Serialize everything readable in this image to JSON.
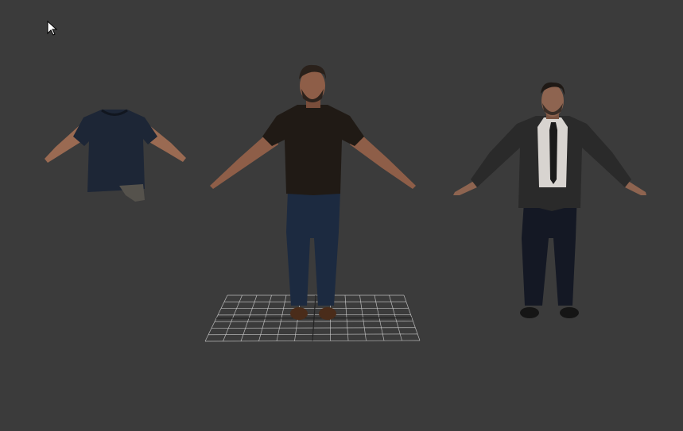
{
  "viewport": {
    "background_color": "#3b3b3b"
  },
  "cursor": {
    "icon": "arrow-pointer-icon"
  },
  "models": [
    {
      "name": "shirt-arms-model",
      "top_color": "#1d2636",
      "skin_color": "#9a6a52"
    },
    {
      "name": "casual-man-model",
      "top_color": "#201a15",
      "pants_color": "#1c2a40",
      "skin_color": "#8e5e48",
      "shoe_color": "#4a2c1a"
    },
    {
      "name": "suit-man-model",
      "jacket_color": "#2a2a2a",
      "shirt_color": "#d8d4d0",
      "pants_color": "#141824",
      "skin_color": "#8e6450",
      "shoe_color": "#151515"
    }
  ],
  "grid": {
    "color": "#d0d0d0",
    "rows": 7,
    "cols": 12
  }
}
